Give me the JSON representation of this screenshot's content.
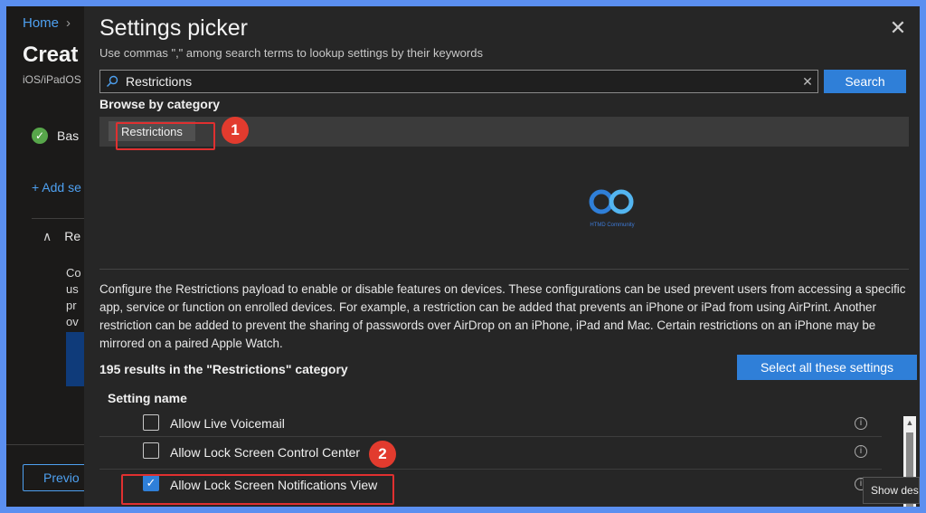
{
  "background_page": {
    "breadcrumb": "Home",
    "title": "Creat",
    "subtitle": "iOS/iPadOS",
    "step_label": "Bas",
    "add_settings": "+ Add se",
    "expander_label": "Re",
    "desc_lines": [
      "Co",
      "us",
      "pr",
      "ov"
    ],
    "previous_button": "Previo"
  },
  "picker": {
    "title": "Settings picker",
    "hint": "Use commas \",\" among search terms to lookup settings by their keywords",
    "search": {
      "value": "Restrictions",
      "button": "Search"
    },
    "browse_label": "Browse by category",
    "category": "Restrictions",
    "logo_text": "HTMD Community",
    "description": "Configure the Restrictions payload to enable or disable features on devices. These configurations can be used prevent users from accessing a specific app, service or function on enrolled devices. For example, a restriction can be added that prevents an iPhone or iPad from using AirPrint. Another restriction can be added to prevent the sharing of passwords over AirDrop on an iPhone, iPad and Mac. Certain restrictions on an iPhone may be mirrored on a paired Apple Watch.",
    "results_text": "195 results in the \"Restrictions\" category",
    "select_all_button": "Select all these settings",
    "column_header": "Setting name",
    "settings": [
      {
        "label": "Allow Live Voicemail",
        "checked": false
      },
      {
        "label": "Allow Lock Screen Control Center",
        "checked": false
      },
      {
        "label": "Allow Lock Screen Notifications View",
        "checked": true
      }
    ]
  },
  "annotations": {
    "step1": "1",
    "step2": "2"
  },
  "tooltip": "Show desk",
  "colors": {
    "accent": "#2f7fd8",
    "highlight": "#e03030",
    "panel": "#262626"
  }
}
